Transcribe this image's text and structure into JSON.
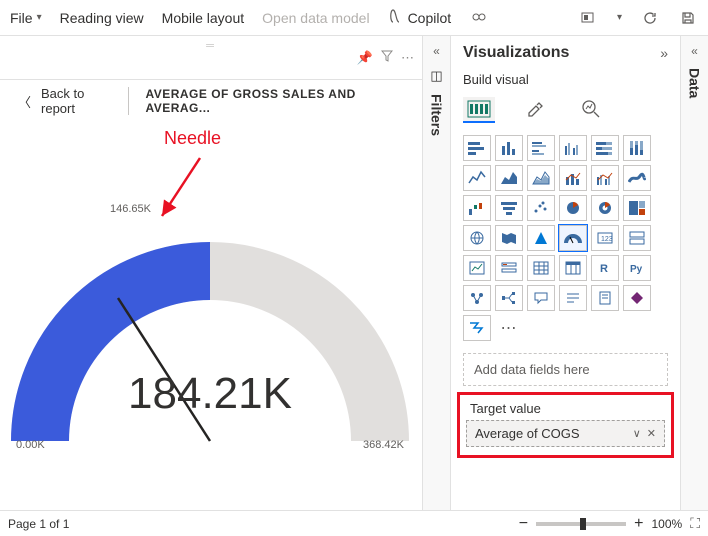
{
  "toolbar": {
    "file": "File",
    "reading_view": "Reading view",
    "mobile_layout": "Mobile layout",
    "open_model": "Open data model",
    "copilot": "Copilot"
  },
  "canvas": {
    "back": "Back to report",
    "title": "AVERAGE OF GROSS SALES AND AVERAG...",
    "annotation": "Needle"
  },
  "chart_data": {
    "type": "gauge",
    "value_label": "184.21K",
    "value": 184.21,
    "min_label": "0.00K",
    "min": 0.0,
    "max_label": "368.42K",
    "max": 368.42,
    "target_label": "146.65K",
    "target": 146.65,
    "fill_color": "#3b5bdb",
    "track_color": "#e1dfdd"
  },
  "filters": {
    "label": "Filters"
  },
  "viz": {
    "title": "Visualizations",
    "subtitle": "Build visual",
    "field_placeholder": "Add data fields here",
    "target_label": "Target value",
    "target_field": "Average of COGS"
  },
  "data_rail": {
    "label": "Data"
  },
  "status": {
    "page": "Page 1 of 1",
    "zoom": "100%"
  }
}
